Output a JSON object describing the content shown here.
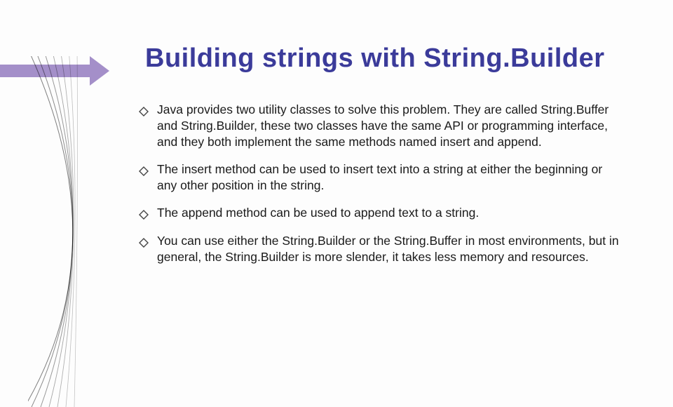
{
  "title": "Building strings with String.Builder",
  "bullets": [
    "Java provides two utility classes to solve this problem. They are called String.Buffer and String.Builder, these two classes have the same API or programming interface, and they both implement the same methods named insert and append.",
    "The insert method can be used to insert text into a string at either the beginning or any other position in the string.",
    "The append method can be used to append text to a string.",
    " You can use either the String.Builder or the String.Buffer in most environments, but in general, the String.Builder is more slender, it takes less memory and resources."
  ],
  "accent_color": "#a48fc9",
  "title_color": "#3b3b9a"
}
